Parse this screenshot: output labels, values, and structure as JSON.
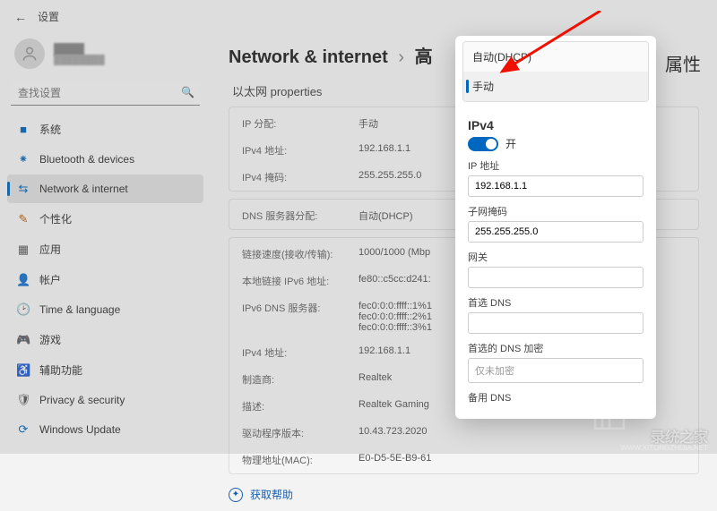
{
  "header": {
    "title": "设置"
  },
  "user": {
    "name": "████",
    "email": "████████"
  },
  "search": {
    "placeholder": "查找设置"
  },
  "sidebar": {
    "items": [
      {
        "icon": "■",
        "color": "#0067c0",
        "label": "系统"
      },
      {
        "icon": "⁕",
        "color": "#0067c0",
        "label": "Bluetooth & devices"
      },
      {
        "icon": "⇆",
        "color": "#0067c0",
        "label": "Network & internet"
      },
      {
        "icon": "✎",
        "color": "#c05b00",
        "label": "个性化"
      },
      {
        "icon": "▦",
        "color": "#5b5b5b",
        "label": "应用"
      },
      {
        "icon": "👤",
        "color": "#5b5b5b",
        "label": "帐户"
      },
      {
        "icon": "🕑",
        "color": "#5b5b5b",
        "label": "Time & language"
      },
      {
        "icon": "🎮",
        "color": "#5b5b5b",
        "label": "游戏"
      },
      {
        "icon": "♿",
        "color": "#0067c0",
        "label": "辅助功能"
      },
      {
        "icon": "🛡",
        "color": "#5b5b5b",
        "label": "Privacy & security"
      },
      {
        "icon": "⟳",
        "color": "#0067c0",
        "label": "Windows Update"
      }
    ]
  },
  "breadcrumb": {
    "a": "Network & internet",
    "b": "高",
    "suffix": "属性"
  },
  "panel": {
    "title": "以太网 properties",
    "rows1": [
      {
        "k": "IP 分配:",
        "v": "手动"
      },
      {
        "k": "IPv4 地址:",
        "v": "192.168.1.1"
      },
      {
        "k": "IPv4 掩码:",
        "v": "255.255.255.0"
      }
    ],
    "rows2": [
      {
        "k": "DNS 服务器分配:",
        "v": "自动(DHCP)"
      }
    ],
    "rows3": [
      {
        "k": "链接速度(接收/传输):",
        "v": "1000/1000 (Mbp"
      },
      {
        "k": "本地链接 IPv6 地址:",
        "v": "fe80::c5cc:d241:"
      },
      {
        "k": "IPv6 DNS 服务器:",
        "v": "fec0:0:0:ffff::1%1\nfec0:0:0:ffff::2%1\nfec0:0:0:ffff::3%1"
      },
      {
        "k": "IPv4 地址:",
        "v": "192.168.1.1"
      },
      {
        "k": "制造商:",
        "v": "Realtek"
      },
      {
        "k": "描述:",
        "v": "Realtek Gaming"
      },
      {
        "k": "驱动程序版本:",
        "v": "10.43.723.2020"
      },
      {
        "k": "物理地址(MAC):",
        "v": "E0-D5-5E-B9-61"
      }
    ],
    "help": "获取帮助"
  },
  "dialog": {
    "dropdown": {
      "opt1": "自动(DHCP)",
      "opt2": "手动"
    },
    "ipv4_heading": "IPv4",
    "toggle_label": "开",
    "fields": {
      "ip_label": "IP 地址",
      "ip_value": "192.168.1.1",
      "mask_label": "子网掩码",
      "mask_value": "255.255.255.0",
      "gw_label": "网关",
      "gw_value": "",
      "dns1_label": "首选 DNS",
      "dns1_value": "",
      "dnsenc_label": "首选的 DNS 加密",
      "dnsenc_value": "仅未加密",
      "dns2_label": "备用 DNS"
    }
  },
  "watermark": {
    "big": "录统之家",
    "small": "WWW.XITONGZHIJIA.NET"
  }
}
